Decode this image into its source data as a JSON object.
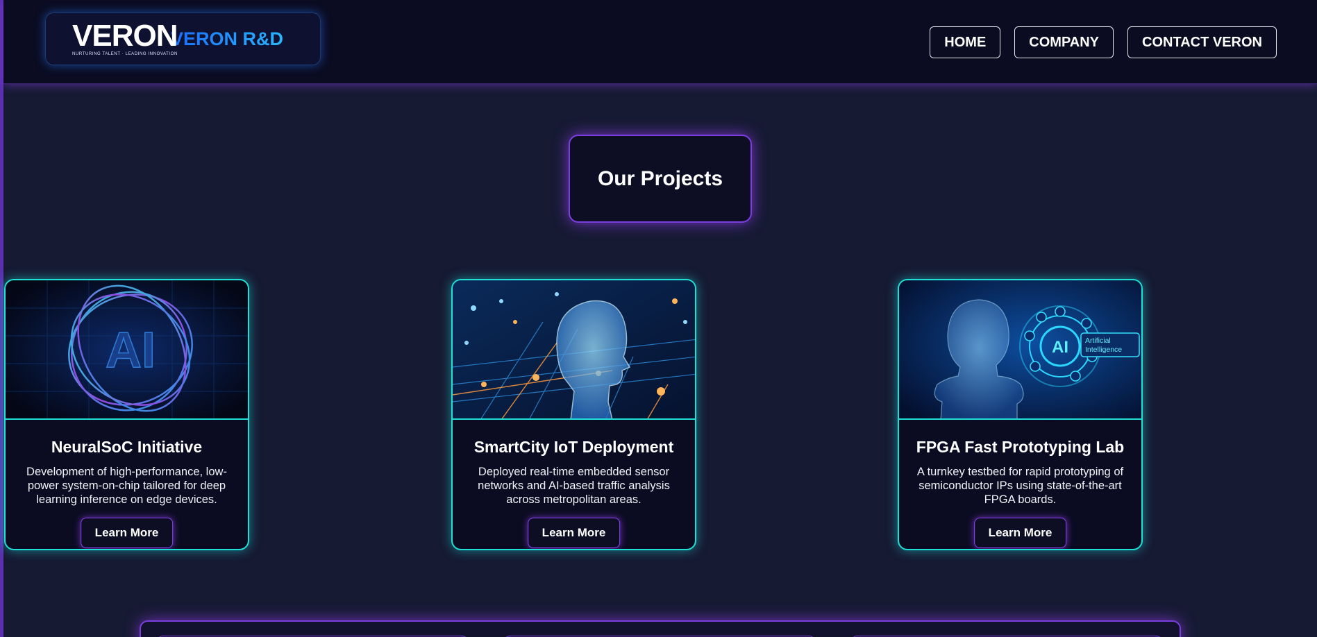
{
  "brand": {
    "logo_word": "VERON",
    "logo_tagline": "NURTURING TALENT · LEADING INNOVATION",
    "name": "VERON R&D"
  },
  "nav": {
    "items": [
      {
        "label": "HOME"
      },
      {
        "label": "COMPANY"
      },
      {
        "label": "CONTACT VERON"
      }
    ]
  },
  "projects": {
    "heading": "Our Projects",
    "cards": [
      {
        "title": "NeuralSoC Initiative",
        "description": "Development of high-performance, low-power system-on-chip tailored for deep learning inference on edge devices.",
        "button": "Learn More",
        "image": "ai-neural-sphere-image"
      },
      {
        "title": "SmartCity IoT Deployment",
        "description": "Deployed real-time embedded sensor networks and AI-based traffic analysis across metropolitan areas.",
        "button": "Learn More",
        "image": "circuit-head-image"
      },
      {
        "title": "FPGA Fast Prototyping Lab",
        "description": "A turnkey testbed for rapid prototyping of semiconductor IPs using state-of-the-art FPGA boards.",
        "button": "Learn More",
        "image": "ai-hologram-image",
        "image_caption": [
          "AI",
          "Artificial",
          "Intelligence"
        ]
      }
    ]
  },
  "colors": {
    "background": "#161a33",
    "header": "#0b0c22",
    "accent_purple": "#7b3fe0",
    "accent_cyan": "#1fe0d6",
    "brand_blue": "#1c86ff"
  }
}
